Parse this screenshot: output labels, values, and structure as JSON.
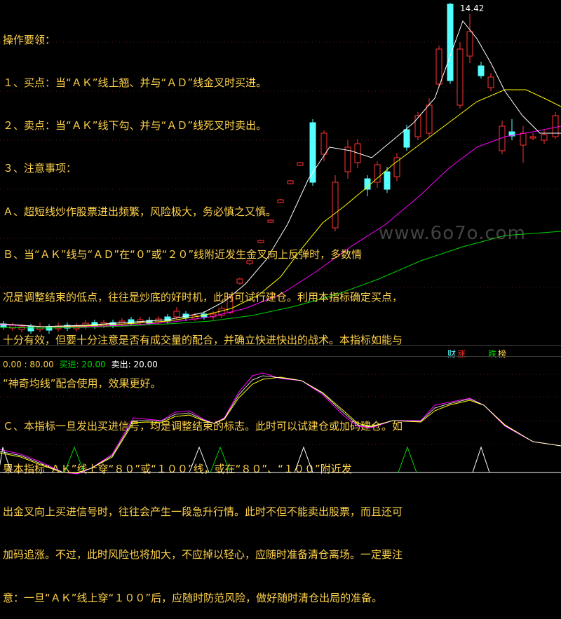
{
  "notes": {
    "title": "操作要领：",
    "l1": "１、买点：当“ＡＫ”线上翘、并与“ＡＤ”线金叉时买进。",
    "l2": "２、卖点：当“ＡＫ”线下勾、并与“ＡＤ”线死叉时卖出。",
    "l3": "３、注意事项：",
    "l4": "Ａ、超短线炒作股票进出频繁，风险极大，务必慎之又慎。",
    "l5": "Ｂ、当“ＡＫ”线与“ＡＤ”在“０”或“２０”线附近发生金叉向上反弹时，多数情",
    "l6": "况是调整结束的低点，往往是炒底的好时机，此时可试行建仓。利用本指标确定买点，",
    "l7": "十分有效，但要十分注意是否有成交量的配合，并确立快进快出的战术。本指标如能与",
    "l8": "“神奇均线”配合使用，效果更好。",
    "l9": "Ｃ、本指标一旦发出买进信号，均是调整结束的标志。此时可以试建仓或加码建仓。如",
    "l10": "果本指标“ＡＫ”线上穿“８０”或“１００”线，或在“８０”、“１００”附近发",
    "l11": "出金叉向上买进信号时，往往会产生一段急升行情。此时不但不能卖出股票，而且还可",
    "l12": "加码追涨。不过，此时风险也将加大，不应掉以轻心，应随时准备清仓离场。一定要注",
    "l13": "意：一旦“ＡＫ”线上穿“１００”后，应随时防范风险，做好随时清仓出局的准备。"
  },
  "high_label": "14.42",
  "watermark": "www.6o7o.com",
  "tags": {
    "cai": "财",
    "zhang": "涨",
    "die": "跌",
    "bang": "榜"
  },
  "legend": {
    "range": "0.00 : 80.00",
    "buy": "买进: 20.00",
    "sell": "卖出: 20.00"
  },
  "colors": {
    "up": "#ff3232",
    "down": "#54ffff",
    "text": "#ffd24a",
    "ma_white": "#ffffff",
    "ma_yellow": "#ffff00",
    "ma_magenta": "#ff00ff",
    "ma_green": "#00d800",
    "buy_signal": "#00d800",
    "sell_signal": "#ffffff"
  }
}
